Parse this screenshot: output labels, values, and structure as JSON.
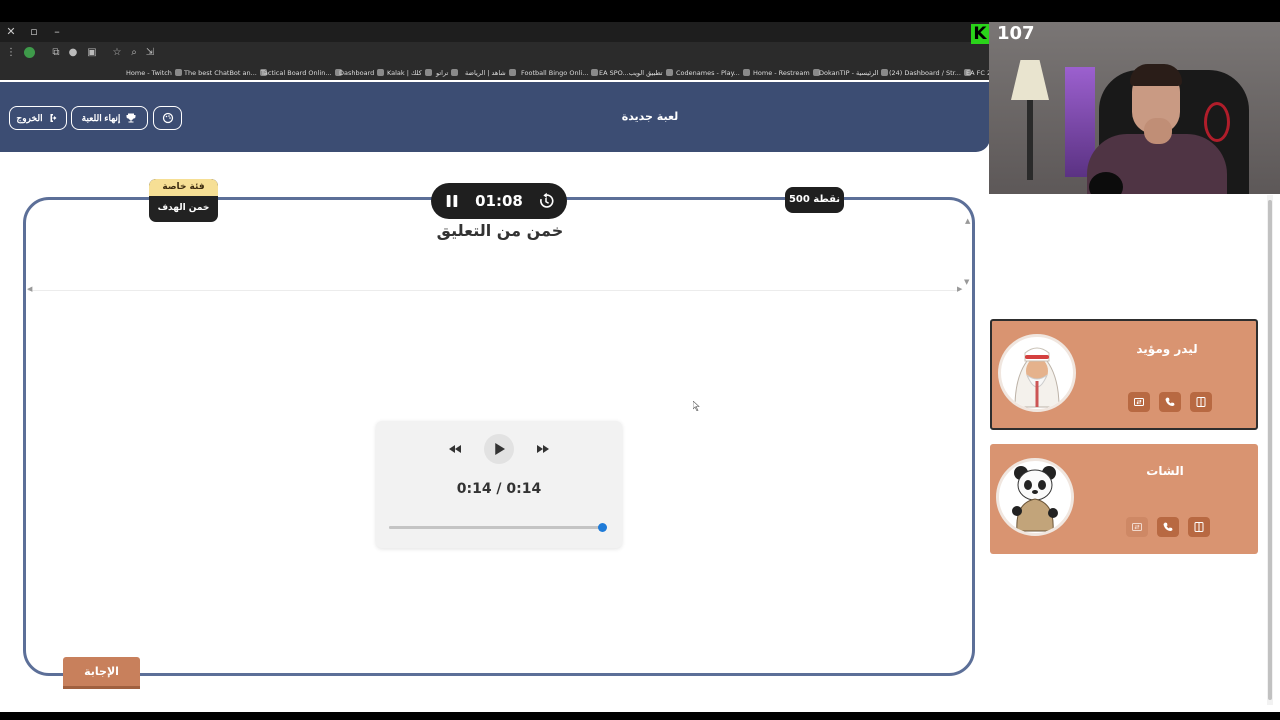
{
  "browser": {
    "bookmarks": [
      "Home - Twitch",
      "The best ChatBot an...",
      "Tactical Board Onlin...",
      "Dashboard",
      "Kalak | كلك",
      "تراتو",
      "شاهد | الرياضة",
      "Football Bingo Onli...",
      "EA SPO...تطبيق الويب",
      "Codenames - Play...",
      "Home - Restream",
      "DokanTIP - الرئيسية",
      "(24) Dashboard / Str...",
      "EA FC 25"
    ]
  },
  "header": {
    "title": "لعبة جديدة",
    "end_game_label": "إنهاء اللعبة",
    "exit_label": "الخروج"
  },
  "category": {
    "label": "فئة خاصة",
    "name": "خمن الهدف"
  },
  "timer": {
    "time": "01:08"
  },
  "points": "500 نقطة",
  "question": "خمن من التعليق",
  "audio": {
    "time": "0:14 / 0:14",
    "progress": 1.0
  },
  "answer_label": "الإجابة",
  "stream": {
    "viewer_count": "107",
    "logo": "K"
  },
  "teams": [
    {
      "name": "ليدر ومؤيد",
      "active": true
    },
    {
      "name": "الشات",
      "active": false
    }
  ],
  "colors": {
    "header": "#3c4d73",
    "board_border": "#5c6f98",
    "team_card": "#d99471",
    "answer_button": "#c8805c",
    "category_label": "#f6df95",
    "progress_thumb": "#1f7bd8"
  }
}
